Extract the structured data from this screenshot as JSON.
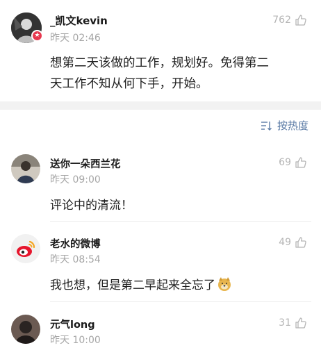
{
  "post": {
    "author": "_凯文kevin",
    "time": "昨天 02:46",
    "likes": "762",
    "text_line1": "想第二天该做的工作，规划好。免得第二",
    "text_line2": "天工作不知从何下手，开始。"
  },
  "sort": {
    "label": "按热度"
  },
  "comments": [
    {
      "author": "送你一朵西兰花",
      "time": "昨天 09:00",
      "likes": "69",
      "text": "评论中的清流！"
    },
    {
      "author": "老水的微博",
      "time": "昨天 08:54",
      "likes": "49",
      "text": "我也想，但是第二早起来全忘了"
    },
    {
      "author": "元气long",
      "time": "昨天 10:00",
      "likes": "31",
      "text": ""
    }
  ]
}
